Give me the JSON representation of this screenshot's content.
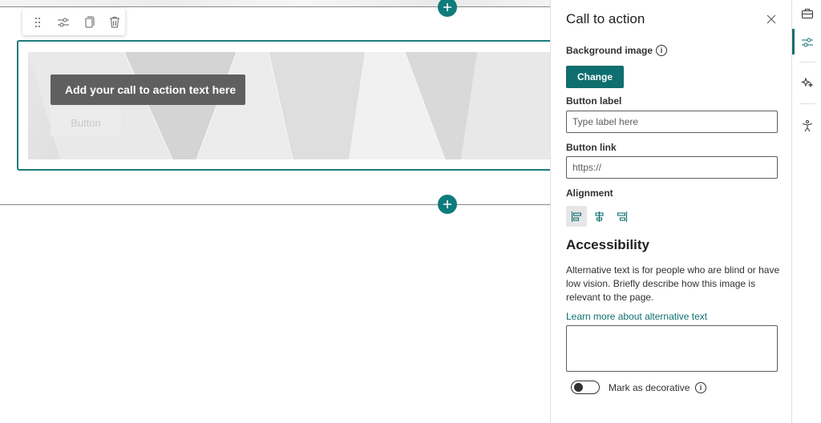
{
  "canvas": {
    "cta_text": "Add your call to action text here",
    "cta_button": "Button"
  },
  "pane": {
    "title": "Call to action",
    "background_image_label": "Background image",
    "change_button": "Change",
    "button_label_label": "Button label",
    "button_label_placeholder": "Type label here",
    "button_link_label": "Button link",
    "button_link_value": "https://",
    "alignment_label": "Alignment",
    "accessibility_title": "Accessibility",
    "accessibility_desc": "Alternative text is for people who are blind or have low vision. Briefly describe how this image is relevant to the page.",
    "learn_more_link": "Learn more about alternative text",
    "alt_text_value": "",
    "decorative_label": "Mark as decorative",
    "decorative_checked": false,
    "info_glyph": "i"
  },
  "colors": {
    "accent": "#0f6e6e",
    "webpart_border": "#1c7c7c"
  },
  "rail": {
    "items": [
      "briefcase-icon",
      "settings-sliders-icon",
      "design-ideas-icon",
      "accessibility-icon"
    ]
  }
}
